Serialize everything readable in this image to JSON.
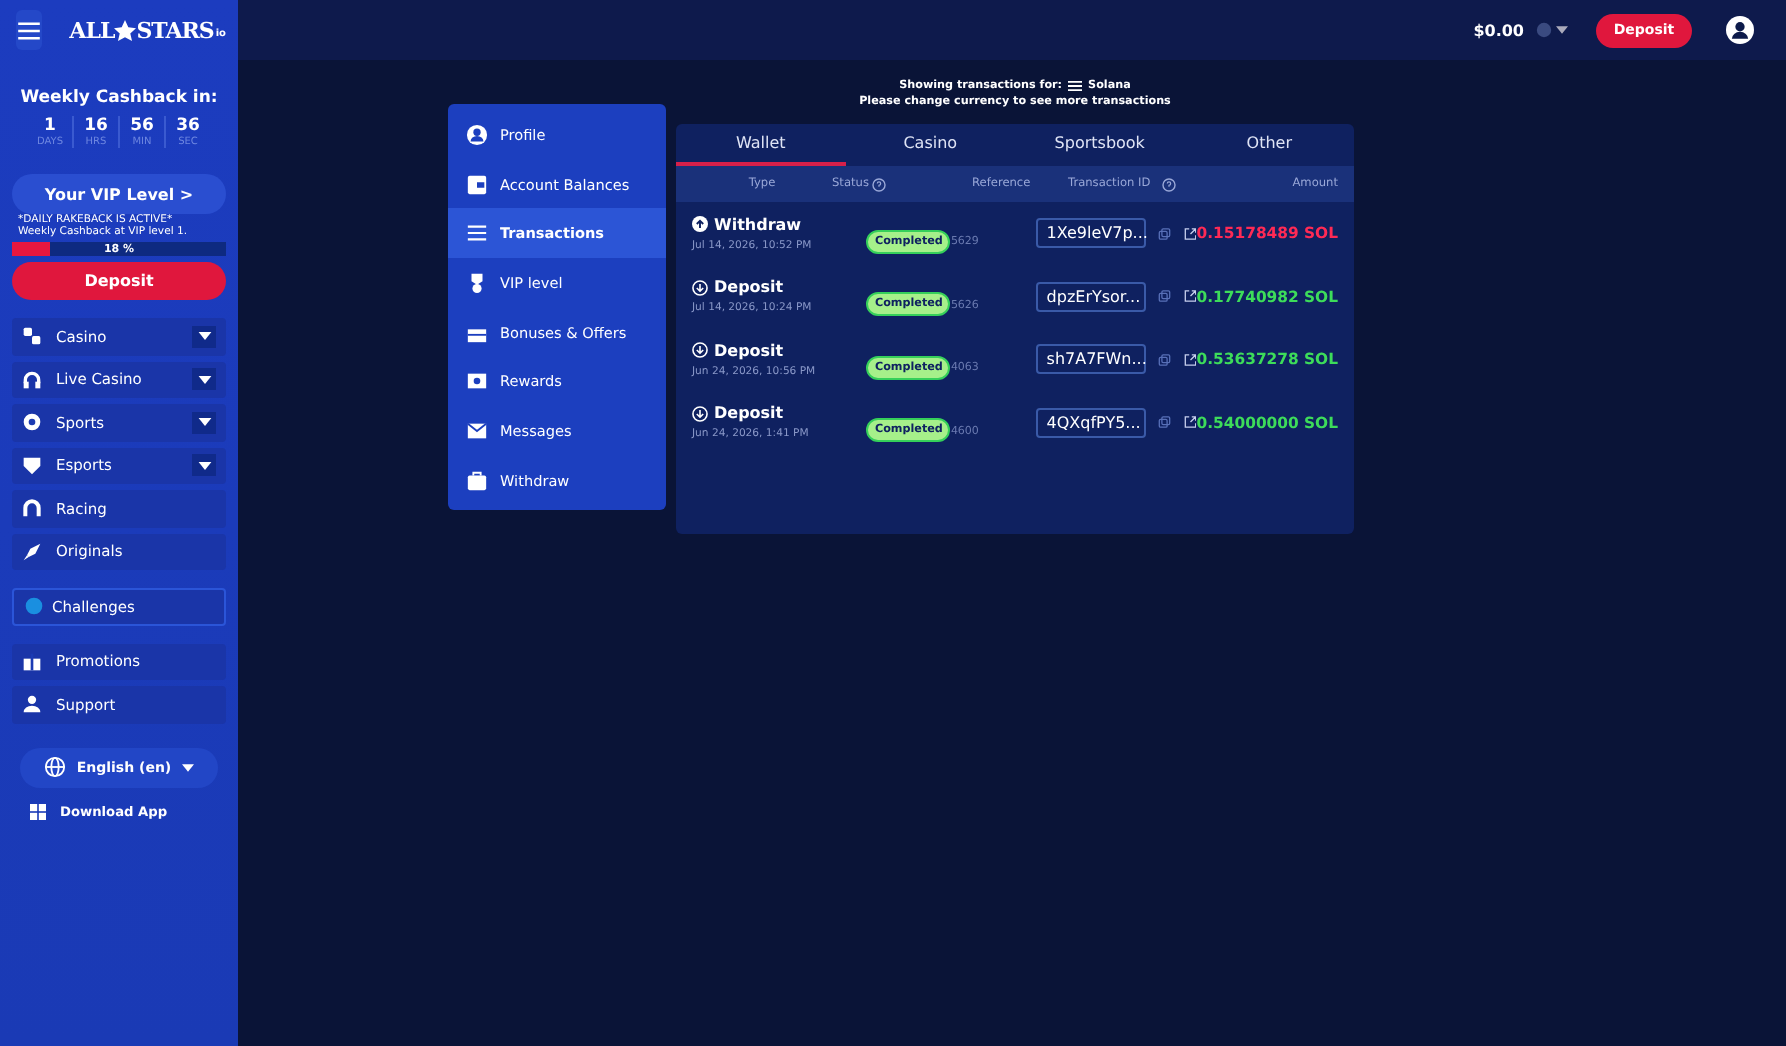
{
  "logo": {
    "left": "ALL",
    "right": "STARS",
    "suffix": "io"
  },
  "cashback": {
    "title": "Weekly Cashback in:",
    "countdown": [
      {
        "value": "1",
        "unit": "DAYS"
      },
      {
        "value": "16",
        "unit": "HRS"
      },
      {
        "value": "56",
        "unit": "MIN"
      },
      {
        "value": "36",
        "unit": "SEC"
      }
    ]
  },
  "vip": {
    "button": "Your VIP Level >",
    "note_1": "*DAILY RAKEBACK IS ACTIVE*",
    "note_2": "Weekly Cashback at VIP level 1.",
    "level": 0.18,
    "percent": "18 %"
  },
  "sidebar_deposit": "Deposit",
  "nav_groups": [
    [
      {
        "label": "Casino",
        "has_dropdown": true
      },
      {
        "label": "Live Casino",
        "has_dropdown": true
      },
      {
        "label": "Sports",
        "has_dropdown": true
      },
      {
        "label": "Esports",
        "has_dropdown": true
      },
      {
        "label": "Racing",
        "has_dropdown": false
      },
      {
        "label": "Originals",
        "has_dropdown": false
      }
    ],
    [
      {
        "label": "Challenges",
        "has_dropdown": false
      }
    ],
    [
      {
        "label": "Promotions",
        "has_dropdown": false
      },
      {
        "label": "Support",
        "has_dropdown": false
      }
    ]
  ],
  "language": "English (en)",
  "download": "Download App",
  "header": {
    "balance": "$0.00",
    "deposit": "Deposit"
  },
  "account_menu": [
    {
      "label": "Profile",
      "selected": false
    },
    {
      "label": "Account Balances",
      "selected": false
    },
    {
      "label": "Transactions",
      "selected": true
    },
    {
      "label": "VIP level",
      "selected": false
    },
    {
      "label": "Bonuses & Offers",
      "selected": false
    },
    {
      "label": "Rewards",
      "selected": false
    },
    {
      "label": "Messages",
      "selected": false
    },
    {
      "label": "Withdraw",
      "selected": false
    }
  ],
  "notice": {
    "prefix": "Showing transactions for:",
    "currency": "Solana",
    "hint": "Please change currency to see more transactions"
  },
  "tabs": [
    {
      "label": "Wallet",
      "selected": true
    },
    {
      "label": "Casino",
      "selected": false
    },
    {
      "label": "Sportsbook",
      "selected": false
    },
    {
      "label": "Other",
      "selected": false
    }
  ],
  "columns": [
    {
      "label": "Type",
      "help": false
    },
    {
      "label": "Status",
      "help": true
    },
    {
      "label": "Reference",
      "help": false
    },
    {
      "label": "Transaction ID",
      "help": true
    },
    {
      "label": "Amount",
      "help": false
    }
  ],
  "rows": [
    {
      "kind": "withdraw",
      "type": "Withdraw",
      "date": "Jul 14, 2026, 10:52 PM",
      "status": "Completed",
      "reference": "5629",
      "tx_id": "1Xe9leV7p...",
      "amount": "0.15178489 SOL"
    },
    {
      "kind": "deposit",
      "type": "Deposit",
      "date": "Jul 14, 2026, 10:24 PM",
      "status": "Completed",
      "reference": "5626",
      "tx_id": "dpzErYsor...",
      "amount": "0.17740982 SOL"
    },
    {
      "kind": "deposit",
      "type": "Deposit",
      "date": "Jun 24, 2026, 10:56 PM",
      "status": "Completed",
      "reference": "4063",
      "tx_id": "sh7A7FWn...",
      "amount": "0.53637278 SOL"
    },
    {
      "kind": "deposit",
      "type": "Deposit",
      "date": "Jun 24, 2026, 1:41 PM",
      "status": "Completed",
      "reference": "4600",
      "tx_id": "4QXqfPY5...",
      "amount": "0.54000000 SOL"
    }
  ]
}
